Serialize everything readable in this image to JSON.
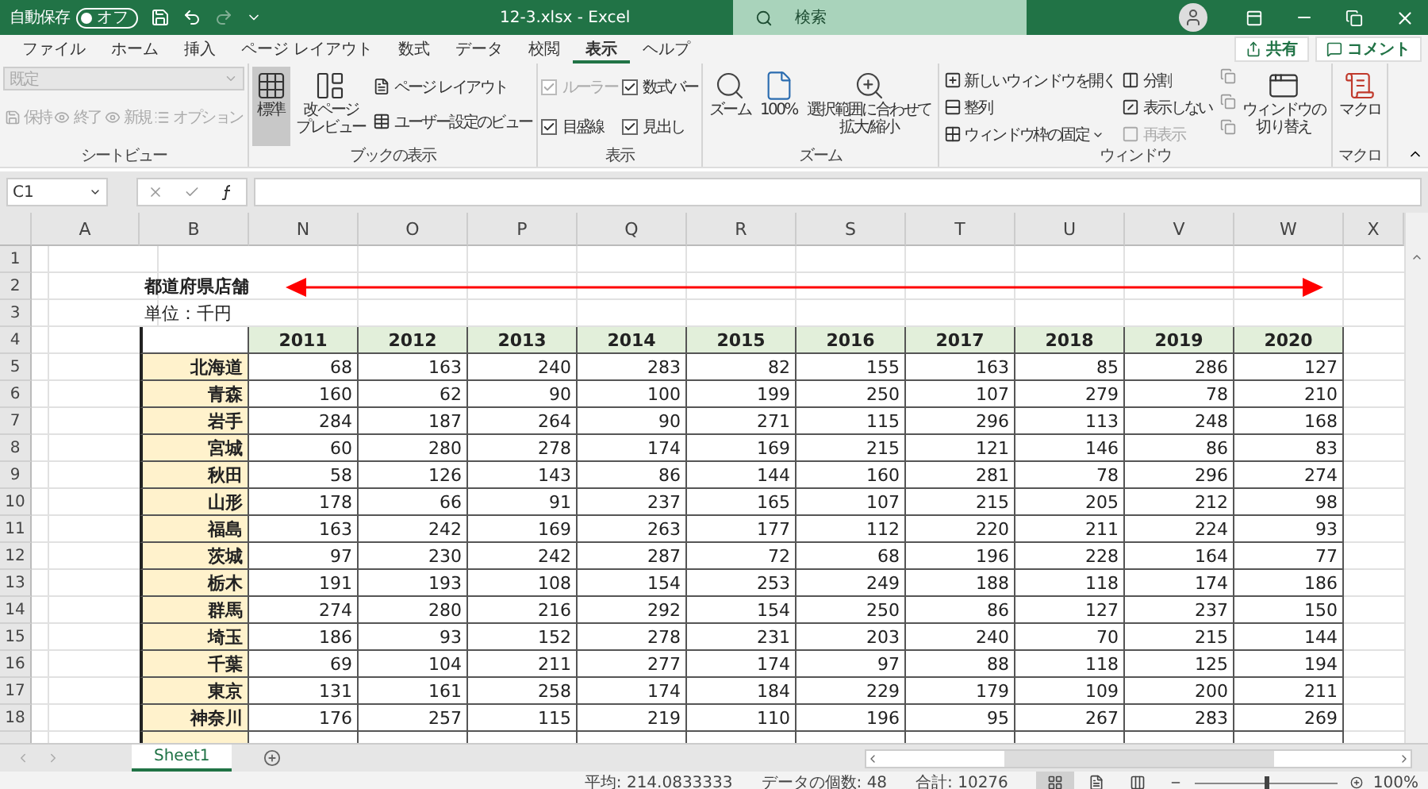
{
  "title_bar": {
    "autosave_label": "自動保存",
    "autosave_state": "オフ",
    "autosave_on": false,
    "file_title": "12-3.xlsx  -  Excel",
    "search_placeholder": "検索"
  },
  "menu_tabs": [
    {
      "label": "ファイル",
      "selected": false
    },
    {
      "label": "ホーム",
      "selected": false
    },
    {
      "label": "挿入",
      "selected": false
    },
    {
      "label": "ページ レイアウト",
      "selected": false
    },
    {
      "label": "数式",
      "selected": false
    },
    {
      "label": "データ",
      "selected": false
    },
    {
      "label": "校閲",
      "selected": false
    },
    {
      "label": "表示",
      "selected": true
    },
    {
      "label": "ヘルプ",
      "selected": false
    }
  ],
  "share_button": "共有",
  "comment_button": "コメント",
  "ribbon": {
    "sheet_view": {
      "dropdown": "既定",
      "buttons": [
        "保持",
        "終了",
        "新規",
        "オプション"
      ],
      "label": "シートビュー"
    },
    "book_view": {
      "large_buttons": [
        {
          "lines": [
            "標準"
          ],
          "selected": true
        },
        {
          "lines": [
            "改ページ",
            "プレビュー"
          ],
          "selected": false
        }
      ],
      "small_buttons": [
        "ページ レイアウト",
        "ユーザー設定のビュー"
      ],
      "label": "ブックの表示"
    },
    "show": {
      "checks": [
        {
          "label": "ルーラー",
          "checked": true,
          "disabled": true
        },
        {
          "label": "数式バー",
          "checked": true,
          "disabled": false
        },
        {
          "label": "目盛線",
          "checked": true,
          "disabled": false
        },
        {
          "label": "見出し",
          "checked": true,
          "disabled": false
        }
      ],
      "label": "表示"
    },
    "zoom": {
      "buttons": [
        {
          "lines": [
            "ズーム"
          ]
        },
        {
          "lines": [
            "100%"
          ]
        },
        {
          "lines": [
            "選択範囲に合わせて",
            "拡大/縮小"
          ]
        }
      ],
      "label": "ズーム"
    },
    "window": {
      "items": [
        {
          "label": "新しいウィンドウを開く",
          "disabled": false,
          "dropdown": false
        },
        {
          "label": "整列",
          "disabled": false,
          "dropdown": false
        },
        {
          "label": "ウィンドウ枠の固定",
          "disabled": false,
          "dropdown": true
        },
        {
          "label": "分割",
          "disabled": false,
          "dropdown": false
        },
        {
          "label": "表示しない",
          "disabled": false,
          "dropdown": false
        },
        {
          "label": "再表示",
          "disabled": true,
          "dropdown": false
        }
      ],
      "switch_button": {
        "lines": [
          "ウィンドウの",
          "切り替え"
        ]
      },
      "label": "ウィンドウ"
    },
    "macro": {
      "button": "マクロ",
      "label": "マクロ"
    }
  },
  "formula_bar": {
    "name_box": "C1"
  },
  "sheet": {
    "columns": [
      "A",
      "B",
      "N",
      "O",
      "P",
      "Q",
      "R",
      "S",
      "T",
      "U",
      "V",
      "W",
      "X"
    ],
    "row_numbers": [
      "1",
      "2",
      "3",
      "4",
      "5",
      "6",
      "7",
      "8",
      "9",
      "10",
      "11",
      "12",
      "13",
      "14",
      "15",
      "16",
      "17",
      "18"
    ],
    "title": "都道府県店舗",
    "unit": "単位：千円",
    "years": [
      "2011",
      "2012",
      "2013",
      "2014",
      "2015",
      "2016",
      "2017",
      "2018",
      "2019",
      "2020"
    ],
    "rows": [
      {
        "name": "北海道",
        "values": [
          "68",
          "163",
          "240",
          "283",
          "82",
          "155",
          "163",
          "85",
          "286",
          "127"
        ]
      },
      {
        "name": "青森",
        "values": [
          "160",
          "62",
          "90",
          "100",
          "199",
          "250",
          "107",
          "279",
          "78",
          "210"
        ]
      },
      {
        "name": "岩手",
        "values": [
          "284",
          "187",
          "264",
          "90",
          "271",
          "115",
          "296",
          "113",
          "248",
          "168"
        ]
      },
      {
        "name": "宮城",
        "values": [
          "60",
          "280",
          "278",
          "174",
          "169",
          "215",
          "121",
          "146",
          "86",
          "83"
        ]
      },
      {
        "name": "秋田",
        "values": [
          "58",
          "126",
          "143",
          "86",
          "144",
          "160",
          "281",
          "78",
          "296",
          "274"
        ]
      },
      {
        "name": "山形",
        "values": [
          "178",
          "66",
          "91",
          "237",
          "165",
          "107",
          "215",
          "205",
          "212",
          "98"
        ]
      },
      {
        "name": "福島",
        "values": [
          "163",
          "242",
          "169",
          "263",
          "177",
          "112",
          "220",
          "211",
          "224",
          "93"
        ]
      },
      {
        "name": "茨城",
        "values": [
          "97",
          "230",
          "242",
          "287",
          "72",
          "68",
          "196",
          "228",
          "164",
          "77"
        ]
      },
      {
        "name": "栃木",
        "values": [
          "191",
          "193",
          "108",
          "154",
          "253",
          "249",
          "188",
          "118",
          "174",
          "186"
        ]
      },
      {
        "name": "群馬",
        "values": [
          "274",
          "280",
          "216",
          "292",
          "154",
          "250",
          "86",
          "127",
          "237",
          "150"
        ]
      },
      {
        "name": "埼玉",
        "values": [
          "186",
          "93",
          "152",
          "278",
          "231",
          "203",
          "240",
          "70",
          "215",
          "144"
        ]
      },
      {
        "name": "千葉",
        "values": [
          "69",
          "104",
          "211",
          "277",
          "174",
          "97",
          "88",
          "118",
          "125",
          "194"
        ]
      },
      {
        "name": "東京",
        "values": [
          "131",
          "161",
          "258",
          "174",
          "184",
          "229",
          "179",
          "109",
          "200",
          "211"
        ]
      },
      {
        "name": "神奈川",
        "values": [
          "176",
          "257",
          "115",
          "219",
          "110",
          "196",
          "95",
          "267",
          "283",
          "269"
        ]
      }
    ]
  },
  "sheet_tabs": [
    {
      "label": "Sheet1",
      "selected": true
    }
  ],
  "status_bar": {
    "average": "平均: 214.0833333",
    "count": "データの個数: 48",
    "sum": "合計: 10276",
    "view_modes": [
      {
        "selected": true
      },
      {
        "selected": false
      },
      {
        "selected": false
      }
    ],
    "zoom": {
      "level": 0.5,
      "reading": "100%"
    }
  }
}
